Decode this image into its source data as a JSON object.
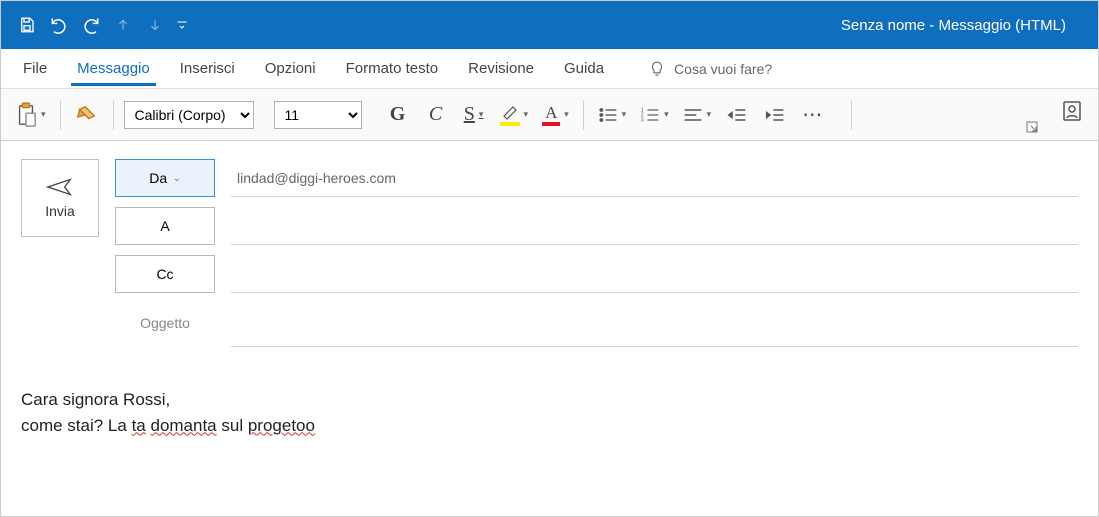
{
  "titlebar": {
    "title": "Senza nome  -  Messaggio (HTML)"
  },
  "tabs": {
    "file": "File",
    "message": "Messaggio",
    "insert": "Inserisci",
    "options": "Opzioni",
    "format": "Formato testo",
    "review": "Revisione",
    "help": "Guida"
  },
  "tellme": {
    "placeholder": "Cosa vuoi fare?"
  },
  "toolbar": {
    "font_name": "Calibri (Corpo)",
    "font_size": "11",
    "bold": "G",
    "italic": "C",
    "underline": "S",
    "highlight": "🖉",
    "fontcolor": "A",
    "more": "⋯"
  },
  "compose": {
    "send_label": "Invia",
    "from_label": "Da",
    "to_label": "A",
    "cc_label": "Cc",
    "subject_label": "Oggetto",
    "from_value": "lindad@diggi-heroes.com",
    "to_value": "",
    "cc_value": "",
    "subject_value": ""
  },
  "body": {
    "line1": "Cara signora Rossi,",
    "line2_pre": "come stai? La ",
    "line2_err1": "ta",
    "line2_mid1": " ",
    "line2_err2": "domanta",
    "line2_mid2": " sul ",
    "line2_err3": "progetoo"
  }
}
